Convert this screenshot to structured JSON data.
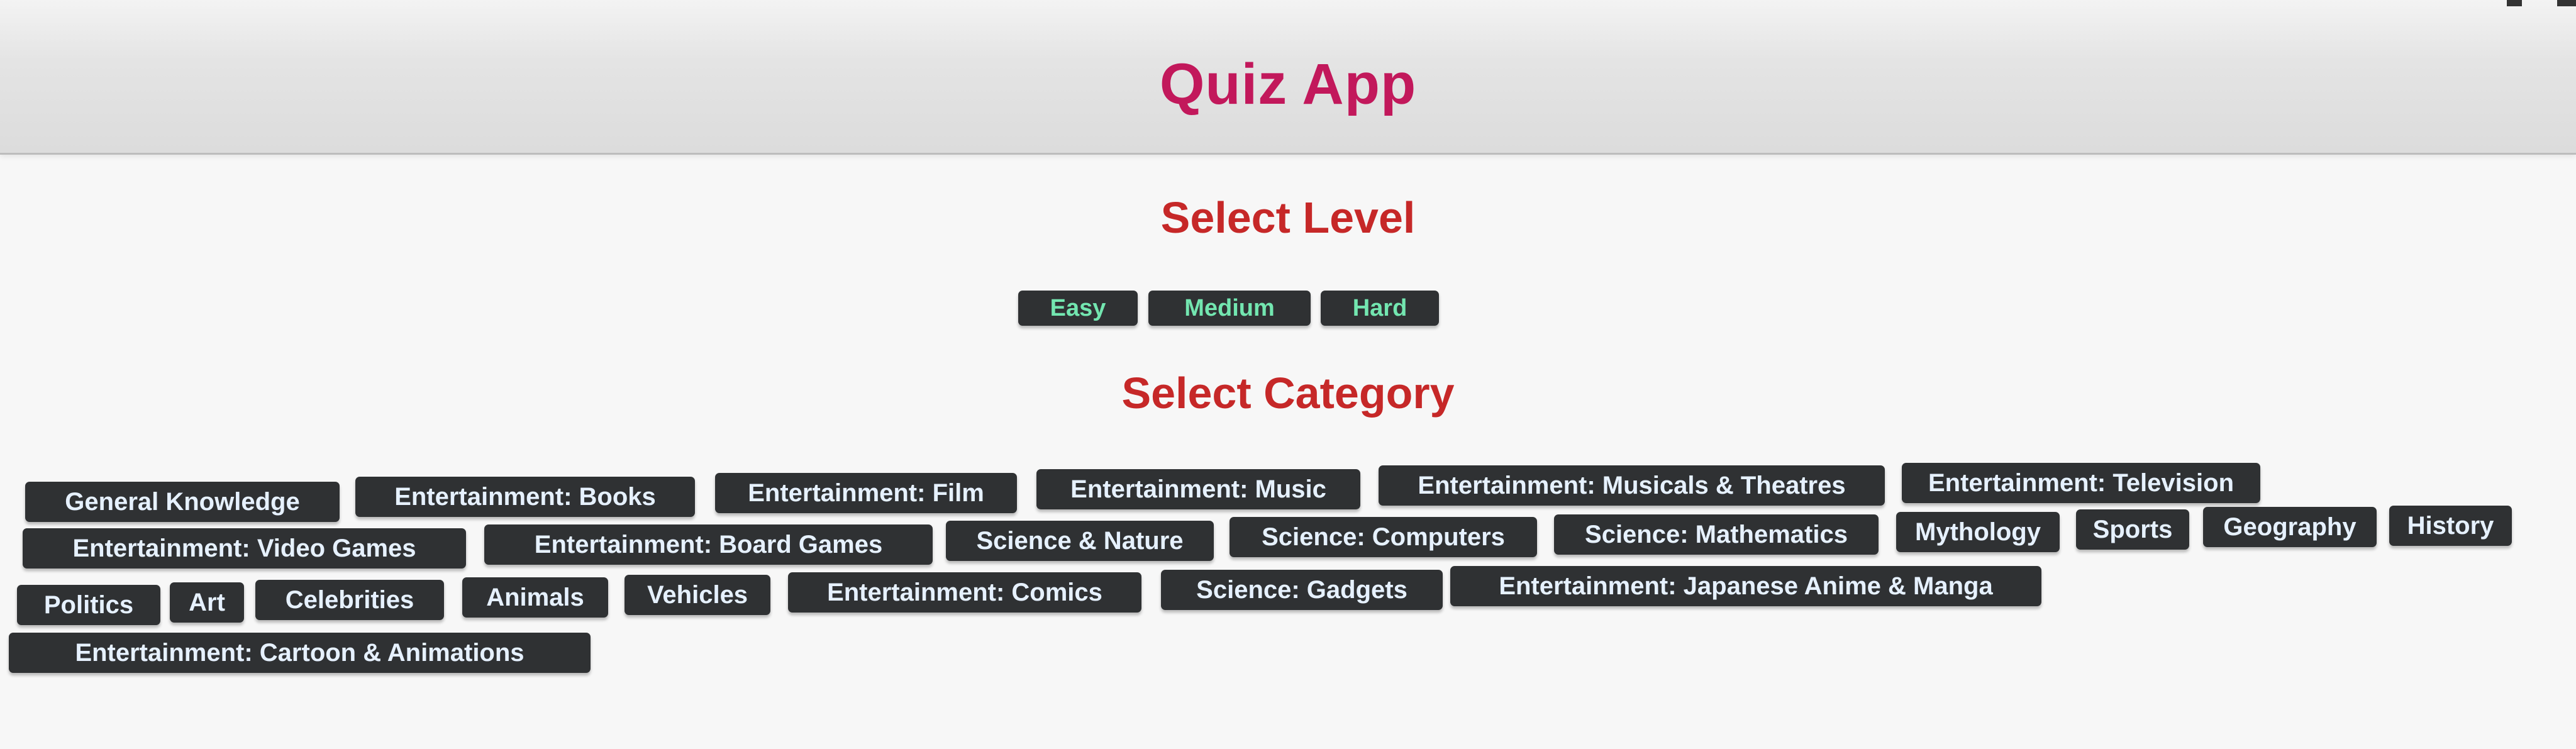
{
  "theme": {
    "title_color": "#c2185b",
    "heading_color": "#c62828",
    "button_bg": "#2f3133",
    "button_fg": "#e6f1ff",
    "level_button_fg": "#73e6b0"
  },
  "header": {
    "title": "Quiz App"
  },
  "levels": {
    "title": "Select Level",
    "options": [
      "Easy",
      "Medium",
      "Hard"
    ]
  },
  "categories": {
    "title": "Select Category",
    "options": [
      "General Knowledge",
      "Entertainment: Books",
      "Entertainment: Film",
      "Entertainment: Music",
      "Entertainment: Musicals & Theatres",
      "Entertainment: Television",
      "Entertainment: Video Games",
      "Entertainment: Board Games",
      "Science & Nature",
      "Science: Computers",
      "Science: Mathematics",
      "Mythology",
      "Sports",
      "Geography",
      "History",
      "Politics",
      "Art",
      "Celebrities",
      "Animals",
      "Vehicles",
      "Entertainment: Comics",
      "Science: Gadgets",
      "Entertainment: Japanese Anime & Manga",
      "Entertainment: Cartoon & Animations"
    ]
  }
}
